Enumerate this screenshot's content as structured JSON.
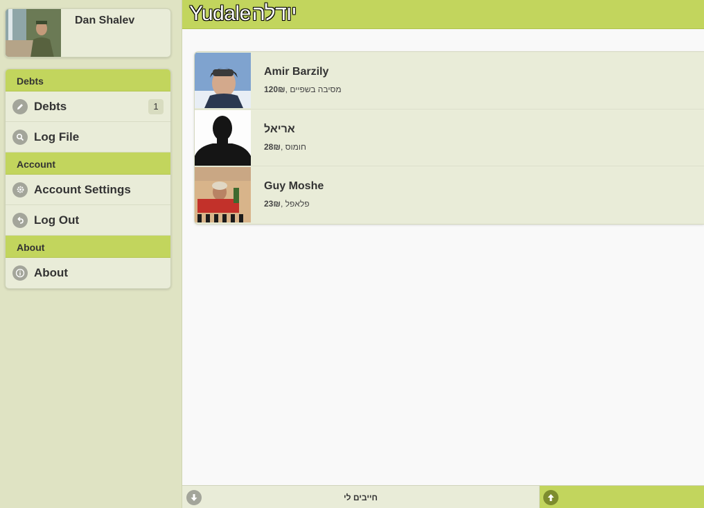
{
  "app": {
    "logo_latin": "Yudale",
    "logo_hebrew": "יודלה"
  },
  "profile": {
    "name": "Dan Shalev"
  },
  "menu": {
    "debts_header": "Debts",
    "debts_label": "Debts",
    "debts_count": "1",
    "logfile_label": "Log File",
    "account_header": "Account",
    "account_settings_label": "Account Settings",
    "logout_label": "Log Out",
    "about_header": "About",
    "about_label": "About"
  },
  "debts": [
    {
      "name": "Amir Barzily",
      "amount": "120₪",
      "note": ", מסיבה בשפיים"
    },
    {
      "name": "אריאל",
      "amount": "28₪",
      "note": ", חומוס"
    },
    {
      "name": "Guy Moshe",
      "amount": "23₪",
      "note": ", פלאפל"
    }
  ],
  "footer": {
    "left_label": "חייבים לי",
    "right_label": ""
  },
  "colors": {
    "accent": "#c2d55d",
    "sidebar_bg": "#dfe3c3",
    "panel_bg": "#e9ecd8"
  }
}
